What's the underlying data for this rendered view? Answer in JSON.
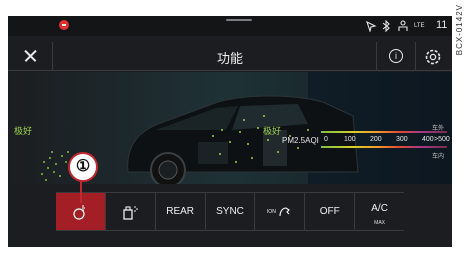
{
  "status_bar": {
    "time": "11",
    "icons": [
      "car-alert-icon",
      "location-icon",
      "bluetooth-icon",
      "person-icon",
      "lte-signal-icon"
    ]
  },
  "title_bar": {
    "title": "功能",
    "info_label": "i"
  },
  "visualization": {
    "outside_quality": "极好",
    "inside_quality": "极好",
    "pm_label": "PM2.5AQI",
    "scale_ticks": [
      "0",
      "100",
      "200",
      "300",
      "400",
      ">500"
    ],
    "outside_label": "车外",
    "inside_label": "车内"
  },
  "controls": [
    {
      "id": "air-purify",
      "label": "",
      "icon": "air-purifier-icon",
      "active": true
    },
    {
      "id": "fragrance",
      "label": "",
      "icon": "fragrance-icon",
      "active": false
    },
    {
      "id": "rear",
      "label": "REAR",
      "active": false
    },
    {
      "id": "sync",
      "label": "SYNC",
      "active": false
    },
    {
      "id": "ion",
      "label": "ION",
      "icon": "ionizer-icon",
      "active": false
    },
    {
      "id": "off",
      "label": "OFF",
      "active": false
    },
    {
      "id": "ac-max",
      "label": "A/C",
      "sub": "MAX",
      "active": false
    }
  ],
  "callout": {
    "number": "①"
  },
  "watermark": "BCX-0142V",
  "colors": {
    "accent": "#a31f25",
    "quality_good": "#9ed24a",
    "background": "#1c1d20"
  }
}
